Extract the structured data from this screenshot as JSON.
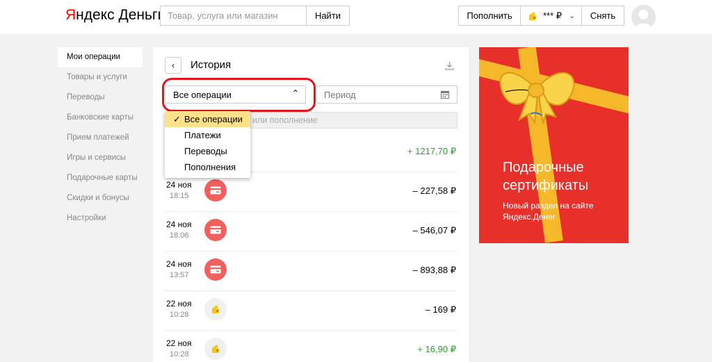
{
  "header": {
    "logo_ya": "Я",
    "logo_ndex": "ндекс",
    "logo_dengi": "Деньги",
    "search_placeholder": "Товар, услуга или магазин",
    "find_label": "Найти",
    "topup_label": "Пополнить",
    "balance": "*** ₽",
    "withdraw_label": "Снять"
  },
  "sidebar": {
    "items": [
      {
        "label": "Мои операции",
        "active": true
      },
      {
        "label": "Товары и услуги"
      },
      {
        "label": "Переводы"
      },
      {
        "label": "Банковские карты"
      },
      {
        "label": "Прием платежей"
      },
      {
        "label": "Игры и сервисы"
      },
      {
        "label": "Подарочные карты"
      },
      {
        "label": "Скидки и бонусы"
      },
      {
        "label": "Настройки"
      }
    ]
  },
  "history": {
    "title": "История",
    "select_value": "Все операции",
    "period_placeholder": "Период",
    "filter_hint": "или пополнение",
    "dropdown": [
      "Все операции",
      "Платежи",
      "Переводы",
      "Пополнения"
    ],
    "rows": [
      {
        "date": "",
        "time": "",
        "amount": "+ 1217,70 ₽",
        "positive": true,
        "icon": "none"
      },
      {
        "date": "24 ноя",
        "time": "18:15",
        "amount": "– 227,58 ₽",
        "positive": false,
        "icon": "card-icon"
      },
      {
        "date": "24 ноя",
        "time": "18:06",
        "amount": "– 546,07 ₽",
        "positive": false,
        "icon": "card-icon"
      },
      {
        "date": "24 ноя",
        "time": "13:57",
        "amount": "– 893,88 ₽",
        "positive": false,
        "icon": "card-icon"
      },
      {
        "date": "22 ноя",
        "time": "10:28",
        "amount": "– 169 ₽",
        "positive": false,
        "icon": "wallet-icon"
      },
      {
        "date": "22 ноя",
        "time": "10:28",
        "amount": "+ 16,90 ₽",
        "positive": true,
        "icon": "wallet-icon"
      }
    ]
  },
  "ad": {
    "title": "Подарочные сертификаты",
    "subtitle": "Новый раздел на сайте Яндекс.Денег"
  },
  "colors": {
    "accent_red": "#e8302b",
    "highlight_yellow": "#fde08a",
    "positive_green": "#2a9e2a",
    "icon_red": "#f0605d"
  }
}
